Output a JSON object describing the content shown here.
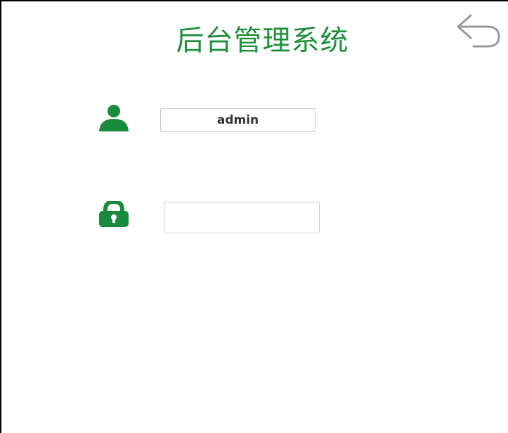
{
  "header": {
    "title": "后台管理系统"
  },
  "icons": {
    "back": "back-arrow-icon",
    "user": "user-icon",
    "lock": "lock-icon"
  },
  "form": {
    "username": {
      "value": "admin",
      "placeholder": ""
    },
    "password": {
      "value": "",
      "placeholder": ""
    }
  },
  "colors": {
    "accent": "#1e8f3a",
    "icon_green": "#1a8a3c",
    "back_icon": "#9a9a9a",
    "field_border": "#c9c9c9",
    "text": "#333333"
  }
}
